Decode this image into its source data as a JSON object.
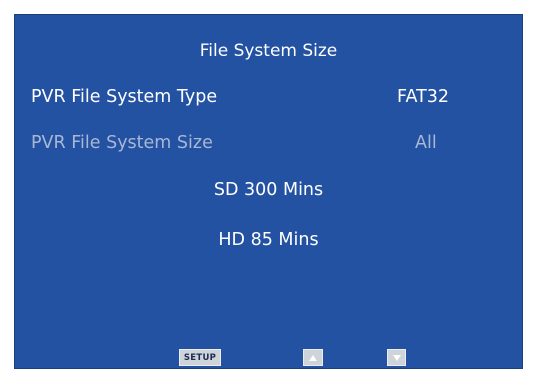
{
  "menu": {
    "title": "File System Size",
    "rows": [
      {
        "label": "PVR File System Type",
        "value": "FAT32",
        "state": "active"
      },
      {
        "label": "PVR File System Size",
        "value": "All",
        "state": "disabled"
      }
    ],
    "capacity": {
      "sd": "SD 300 Mins",
      "hd": "HD 85 Mins"
    }
  },
  "footer": {
    "setup_label": "SETUP",
    "up_icon": "arrow-up-icon",
    "down_icon": "arrow-down-icon"
  },
  "colors": {
    "background": "#2352a3",
    "text_active": "#ffffff",
    "text_disabled": "#a9b7d4"
  }
}
